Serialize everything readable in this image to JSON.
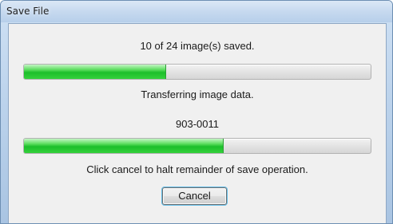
{
  "window": {
    "title": "Save File"
  },
  "status": {
    "images_saved": "10 of 24 image(s) saved.",
    "overall_progress": 0.41,
    "activity": "Transferring image data.",
    "current_item": "903-0011",
    "item_progress": 0.575,
    "instruction": "Click cancel to halt remainder of save operation."
  },
  "buttons": {
    "cancel_label": "Cancel"
  },
  "colors": {
    "progress_fill": "#1cbf2b",
    "title_bar": "#c6d9ef",
    "focus_ring": "#60bce8"
  }
}
